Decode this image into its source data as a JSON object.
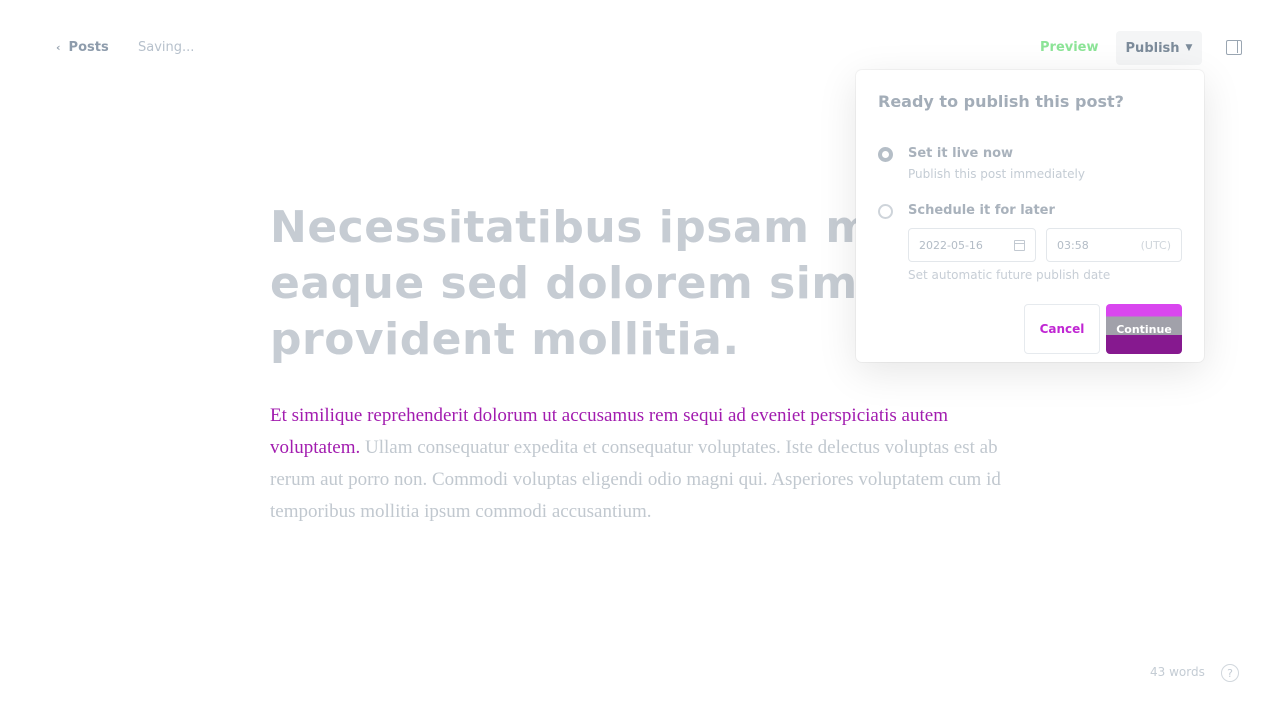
{
  "header": {
    "back_label": "Posts",
    "back_icon": "chevron-left-icon",
    "status": "Saving...",
    "preview_label": "Preview",
    "publish_label": "Publish",
    "publish_caret": "chevron-down-icon",
    "sidebar_icon": "sidebar-toggle-icon",
    "accent_color": "#30cf43"
  },
  "post": {
    "title": "Necessitatibus ipsam magni eaque sed dolorem similique provident mollitia.",
    "excerpt_lead": "Et similique reprehenderit dolorum ut accusamus rem sequi ad eveniet perspiciatis autem voluptatem.",
    "body": "Ullam consequatur expedita et consequatur voluptates. Iste delectus voluptas est ab rerum aut porro non. Commodi voluptas eligendi odio magni qui. Asperiores voluptatem cum id temporibus mollitia ipsum commodi accusantium."
  },
  "publish_menu": {
    "heading": "Ready to publish this post?",
    "options": [
      {
        "label": "Set it live now",
        "description": "Publish this post immediately",
        "selected": true
      },
      {
        "label": "Schedule it for later",
        "description": "",
        "selected": false
      }
    ],
    "date_value": "2022-05-16",
    "time_value": "03:58",
    "timezone": "(UTC)",
    "schedule_help": "Set automatic future publish date",
    "cancel_label": "Cancel",
    "continue_label": "Continue",
    "brand_color": "#d946ef"
  },
  "footer": {
    "word_count": "43 words",
    "help_label": "?"
  }
}
